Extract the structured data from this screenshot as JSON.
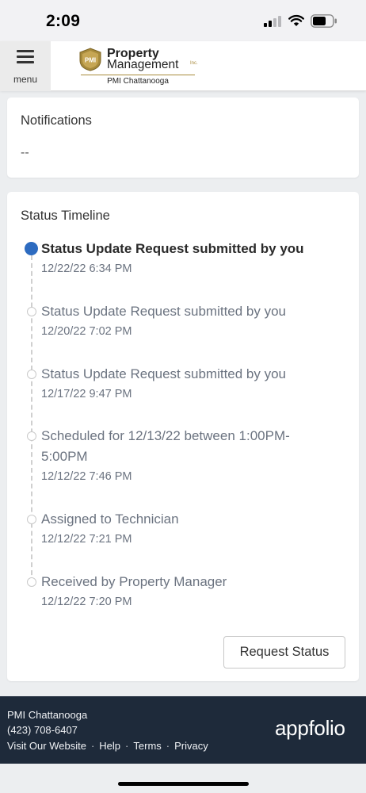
{
  "status_bar": {
    "time": "2:09"
  },
  "header": {
    "menu_label": "menu",
    "logo_badge": "PMI",
    "logo_line1": "Property",
    "logo_line2": "Management",
    "logo_inc": "Inc.",
    "logo_sub": "PMI Chattanooga"
  },
  "notifications": {
    "title": "Notifications",
    "empty_text": "--"
  },
  "timeline": {
    "title": "Status Timeline",
    "items": [
      {
        "text": "Status Update Request submitted by you",
        "date": "12/22/22 6:34 PM"
      },
      {
        "text": "Status Update Request submitted by you",
        "date": "12/20/22 7:02 PM"
      },
      {
        "text": "Status Update Request submitted by you",
        "date": "12/17/22 9:47 PM"
      },
      {
        "text": "Scheduled for 12/13/22 between 1:00PM-5:00PM",
        "date": "12/12/22 7:46 PM"
      },
      {
        "text": "Assigned to Technician",
        "date": "12/12/22 7:21 PM"
      },
      {
        "text": "Received by Property Manager",
        "date": "12/12/22 7:20 PM"
      }
    ],
    "button_label": "Request Status"
  },
  "footer": {
    "company": "PMI Chattanooga",
    "phone": "(423) 708-6407",
    "links": [
      "Visit Our Website",
      "Help",
      "Terms",
      "Privacy"
    ],
    "separator": "·",
    "brand": "appfolio"
  },
  "colors": {
    "accent_blue": "#2d6bc0",
    "footer_bg": "#1e2a3a",
    "logo_gold": "#a78a3b"
  }
}
